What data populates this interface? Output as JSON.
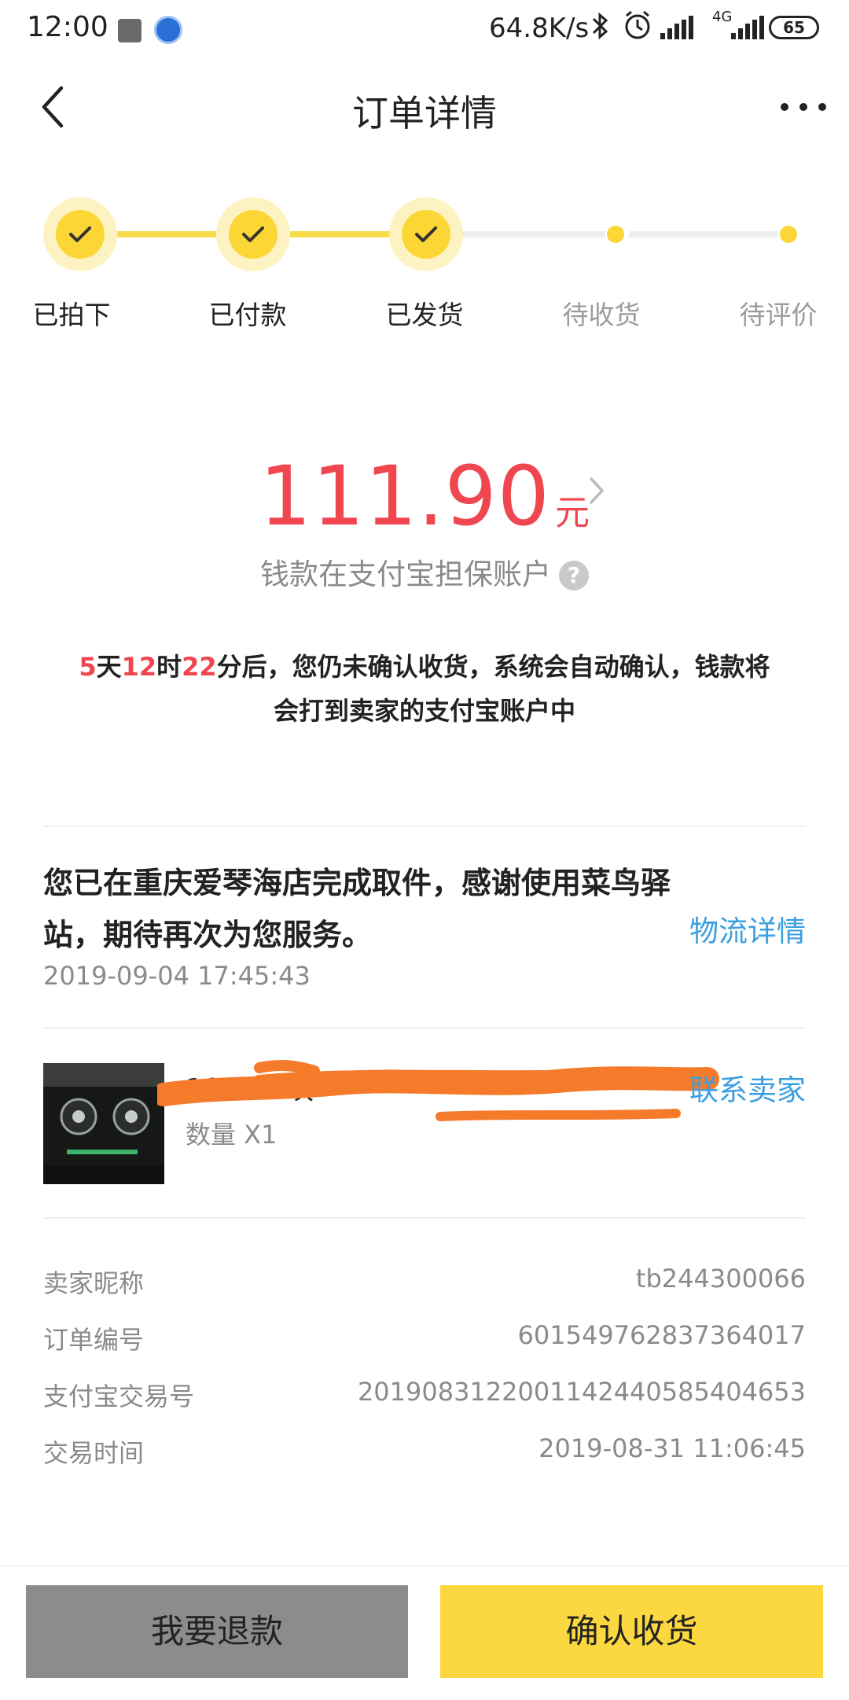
{
  "status_bar": {
    "time": "12:00",
    "network_speed": "64.8K/s",
    "network_type": "4G",
    "battery": "65",
    "icons": [
      "notification-square-icon",
      "app-icon",
      "bluetooth-icon",
      "alarm-icon",
      "signal-icon",
      "signal-4g-icon",
      "battery-icon"
    ]
  },
  "header": {
    "title": "订单详情",
    "back_icon": "chevron-left-icon",
    "more_icon": "more-dots-icon"
  },
  "progress": {
    "steps": [
      {
        "label": "已拍下",
        "state": "done"
      },
      {
        "label": "已付款",
        "state": "done"
      },
      {
        "label": "已发货",
        "state": "done"
      },
      {
        "label": "待收货",
        "state": "pending"
      },
      {
        "label": "待评价",
        "state": "pending"
      }
    ],
    "active_color": "#fbd634"
  },
  "amount": {
    "value": "111.90",
    "currency": "元",
    "escrow_text": "钱款在支付宝担保账户",
    "help_icon": "?"
  },
  "notice": {
    "days": "5",
    "days_unit": "天",
    "hours": "12",
    "hours_unit": "时",
    "minutes": "22",
    "text": "分后，您仍未确认收货，系统会自动确认，钱款将会打到卖家的支付宝账户中"
  },
  "logistics": {
    "message": "您已在重庆爱琴海店完成取件，感谢使用菜鸟驿站，期待再次为您服务。",
    "time": "2019-09-04 17:45:43",
    "link": "物流详情"
  },
  "product": {
    "title_visible": "1060ti 映",
    "quantity": "数量 X1",
    "contact": "联系卖家"
  },
  "info": {
    "rows": [
      {
        "label": "卖家昵称",
        "value": "tb244300066"
      },
      {
        "label": "订单编号",
        "value": "601549762837364017"
      },
      {
        "label": "支付宝交易号",
        "value": "2019083122001142440585404653"
      },
      {
        "label": "交易时间",
        "value": "2019-08-31 11:06:45"
      }
    ]
  },
  "actions": {
    "refund": "我要退款",
    "confirm": "确认收货"
  },
  "colors": {
    "accent_yellow": "#fcd840",
    "price_red": "#f0464f",
    "link_blue": "#3b9fe0",
    "refund_gray": "#8c8c8c"
  }
}
